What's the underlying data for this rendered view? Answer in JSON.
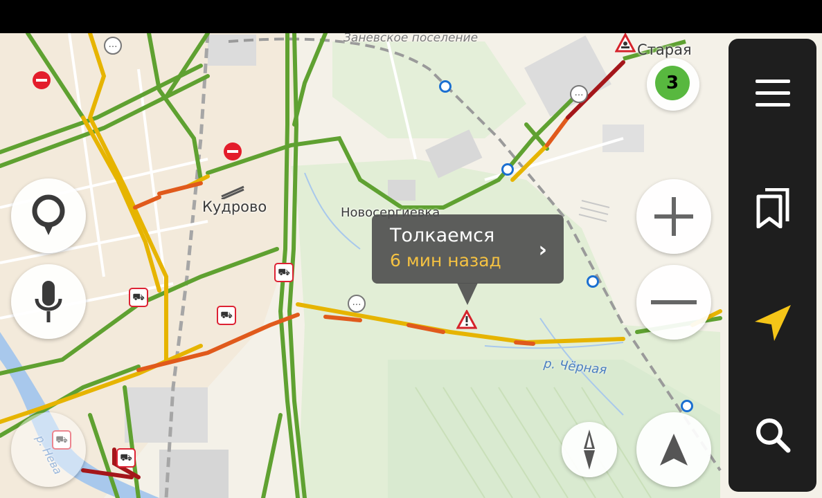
{
  "map": {
    "places": {
      "kudrovo": "Кудрово",
      "novosergievka": "Новосергиевка",
      "staraya": "Старая",
      "zanevskoe": "Заневское поселение",
      "river_chernaya": "р. Чёрная",
      "river_neva": "р. Нева"
    },
    "jam_level": "3",
    "colors": {
      "free": "#5fa131",
      "slow": "#e6b400",
      "jam": "#e05a1c",
      "heavy": "#a4161a",
      "forest": "#dfeccf",
      "water": "#a8c8ec"
    }
  },
  "popup": {
    "title": "Толкаемся",
    "time": "6 мин назад",
    "chevron": "›"
  },
  "controls": {
    "search_pin_icon": "map-pin-icon",
    "voice_icon": "microphone-icon",
    "zoom_in_icon": "plus-icon",
    "zoom_out_icon": "minus-icon",
    "compass_icon": "compass-icon",
    "navigate_icon": "north-arrow-icon"
  },
  "sidebar": {
    "menu_icon": "hamburger-icon",
    "bookmarks_icon": "bookmarks-icon",
    "locate_icon": "location-arrow-icon",
    "search_icon": "search-icon"
  }
}
